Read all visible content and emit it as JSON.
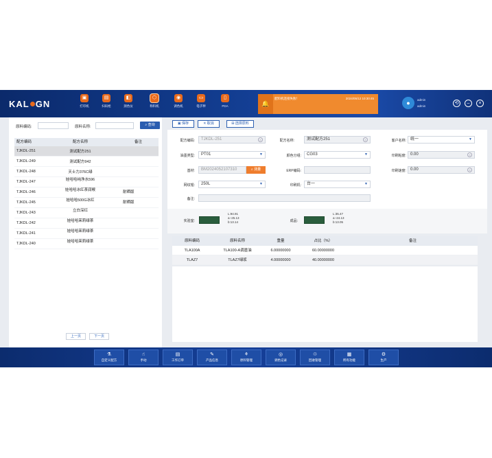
{
  "header": {
    "logo_text_a": "KAL",
    "logo_text_b": "GN",
    "nav": [
      {
        "label": "打印机",
        "icon": "printer-icon",
        "glyph": "▣"
      },
      {
        "label": "扫码枪",
        "icon": "scanner-icon",
        "glyph": "▤"
      },
      {
        "label": "测色仪",
        "icon": "colorimeter-icon",
        "glyph": "◧"
      },
      {
        "label": "称料机",
        "icon": "dispenser-icon",
        "glyph": "⬡"
      },
      {
        "label": "调色机",
        "icon": "tinting-machine-icon",
        "glyph": "◉"
      },
      {
        "label": "电子秤",
        "icon": "scale-icon",
        "glyph": "▭"
      },
      {
        "label": "PDA",
        "icon": "pda-icon",
        "glyph": "▯"
      }
    ],
    "notice_message": "配料机连接失败！",
    "notice_time": "2024/05/12 10:30:45",
    "user_line1": "admin",
    "user_line2": "admin"
  },
  "filters": {
    "material_code_label": "原料编码:",
    "material_name_label": "原料名称:",
    "query_label": "查询"
  },
  "recipe_table": {
    "headers": [
      "配方编码",
      "配方名称",
      "备注"
    ],
    "rows": [
      {
        "code": "TJKDL-251",
        "name": "测试配方251",
        "note": ""
      },
      {
        "code": "TJKDL-249",
        "name": "测试配方942",
        "note": ""
      },
      {
        "code": "TJKDL-248",
        "name": "天士力376C绿",
        "note": ""
      },
      {
        "code": "TJKDL-247",
        "name": "娃哈哈纯净水596",
        "note": ""
      },
      {
        "code": "TJKDL-246",
        "name": "娃哈哈冰红茶润喉",
        "note": "耐晒版"
      },
      {
        "code": "TJKDL-245",
        "name": "娃哈哈500G冰红",
        "note": "耐晒版"
      },
      {
        "code": "TJKDL-243",
        "name": "立白深红",
        "note": ""
      },
      {
        "code": "TJKDL-242",
        "name": "娃哈哈茉莉绿茶",
        "note": ""
      },
      {
        "code": "TJKDL-241",
        "name": "娃哈哈茉莉绿茶",
        "note": ""
      },
      {
        "code": "TJKDL-240",
        "name": "娃哈哈茉莉绿茶",
        "note": ""
      }
    ],
    "prev_label": "上一页",
    "next_label": "下一页"
  },
  "toolbar": {
    "save_label": "保存",
    "cancel_label": "取消",
    "select_material_label": "选择原料"
  },
  "form": {
    "recipe_code_label": "配方编码:",
    "recipe_code_value": "TJKDL-251",
    "recipe_name_label": "配方名称:",
    "recipe_name_value": "测试配方251",
    "customer_label": "客户名称:",
    "customer_value": "统一",
    "ink_type_label": "油墨类型:",
    "ink_type_value": "PT01",
    "color_group_label": "颜色分组:",
    "color_group_value": "CG03",
    "print_viscosity_label": "印刷粘度:",
    "print_viscosity_value": "0.00",
    "substrate_label": "基材:",
    "substrate_value": "BM2024052107310",
    "measure_label": "测量",
    "erp_code_label": "ERP编码:",
    "erp_code_value": "",
    "print_speed_label": "印刷速度:",
    "print_speed_value": "0.00",
    "consumable_label": "网纹辊:",
    "consumable_value": "250L",
    "printer_label": "印刷机:",
    "printer_value": "台一",
    "remark_label": "备注:",
    "remark_value": ""
  },
  "color": {
    "sample_label": "实验室:",
    "sample_lab": [
      "L:94.91",
      "a:-25.13",
      "b:13.14"
    ],
    "product_label": "成品:",
    "product_lab": [
      "L:35.47",
      "a:-24.13",
      "b:13.05"
    ],
    "swatch_color": "#2a5d3d"
  },
  "material_table": {
    "headers": [
      "原料编码",
      "原料名称",
      "重量",
      "占比（%）",
      "备注"
    ],
    "rows": [
      {
        "code": "TLA100A",
        "name": "TLA100-A调墨油",
        "weight": "6.00000000",
        "ratio": "60.00000000",
        "note": ""
      },
      {
        "code": "TLAZ7",
        "name": "TLAZ7绿浆",
        "weight": "4.00000000",
        "ratio": "40.00000000",
        "note": ""
      }
    ]
  },
  "footer": [
    {
      "label": "自定义配方",
      "icon": "flask-icon",
      "glyph": "⚗"
    },
    {
      "label": "手动",
      "icon": "hand-icon",
      "glyph": "☝"
    },
    {
      "label": "工作订单",
      "icon": "order-icon",
      "glyph": "▤"
    },
    {
      "label": "产品信息",
      "icon": "product-icon",
      "glyph": "✎"
    },
    {
      "label": "原料管理",
      "icon": "material-icon",
      "glyph": "⚘"
    },
    {
      "label": "调色记录",
      "icon": "record-icon",
      "glyph": "◎"
    },
    {
      "label": "回收管理",
      "icon": "recycle-icon",
      "glyph": "♲"
    },
    {
      "label": "所有功能",
      "icon": "grid-icon",
      "glyph": "▦"
    },
    {
      "label": "生产",
      "icon": "production-icon",
      "glyph": "⚙"
    }
  ]
}
